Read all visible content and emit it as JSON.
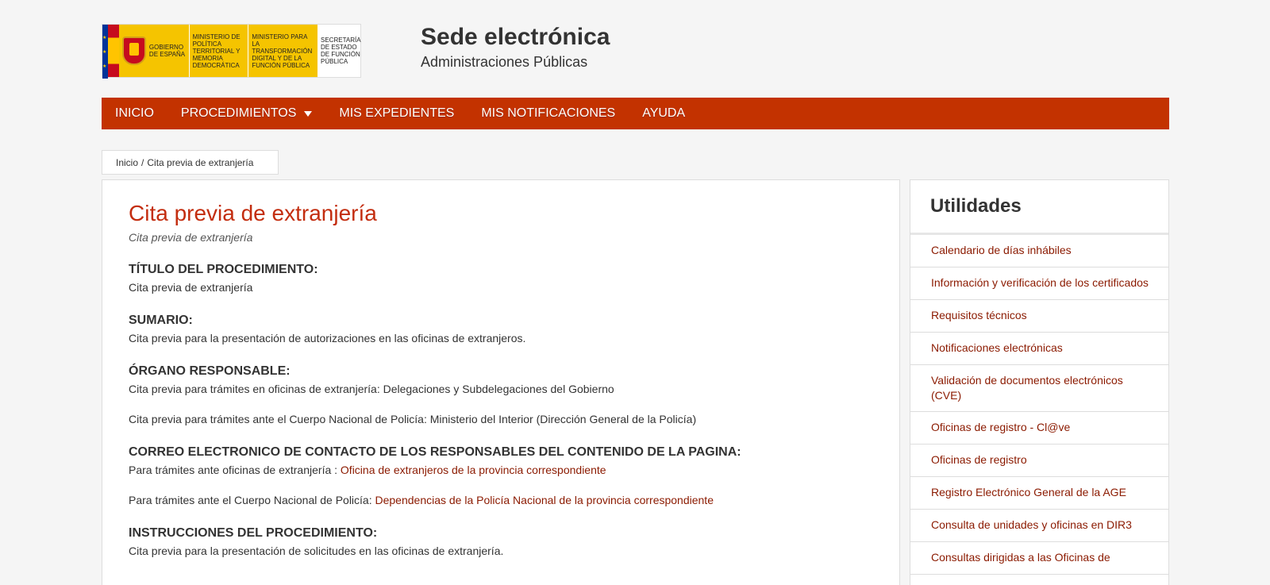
{
  "header": {
    "logo": {
      "block1": "GOBIERNO DE ESPAÑA",
      "block2": "MINISTERIO DE POLÍTICA TERRITORIAL Y MEMORIA DEMOCRÁTICA",
      "block3": "MINISTERIO PARA LA TRANSFORMACIÓN DIGITAL Y DE LA FUNCIÓN PÚBLICA",
      "block4": "SECRETARÍA DE ESTADO DE FUNCIÓN PÚBLICA"
    },
    "title": "Sede electrónica",
    "subtitle": "Administraciones Públicas"
  },
  "nav": {
    "items": [
      "INICIO",
      "PROCEDIMIENTOS",
      "MIS EXPEDIENTES",
      "MIS NOTIFICACIONES",
      "AYUDA"
    ]
  },
  "breadcrumb": {
    "home": "Inicio",
    "separator": "/",
    "current": "Cita previa de extranjería"
  },
  "main": {
    "title": "Cita previa de extranjería",
    "subtitle": "Cita previa de extranjería",
    "sections": {
      "titulo": {
        "heading": "TÍTULO DEL PROCEDIMIENTO:",
        "text": "Cita previa de extranjería"
      },
      "sumario": {
        "heading": "SUMARIO:",
        "text": "Cita previa para la presentación de autorizaciones en las oficinas de extranjeros."
      },
      "organo": {
        "heading": "ÓRGANO RESPONSABLE:",
        "text1": "Cita previa para trámites en oficinas de extranjería: Delegaciones y Subdelegaciones del Gobierno",
        "text2": "Cita previa para trámites ante el Cuerpo Nacional de Policía: Ministerio del Interior (Dirección General de la Policía)"
      },
      "correo": {
        "heading": "CORREO ELECTRONICO DE CONTACTO DE LOS RESPONSABLES DEL CONTENIDO DE LA PAGINA:",
        "line1_prefix": "Para trámites ante oficinas de extranjería : ",
        "line1_link": "Oficina de extranjeros de la provincia correspondiente",
        "line2_prefix": "Para trámites ante el Cuerpo Nacional de Policía: ",
        "line2_link": "Dependencias de la Policía Nacional de la provincia correspondiente"
      },
      "instrucciones": {
        "heading": "INSTRUCCIONES DEL PROCEDIMIENTO:",
        "text": "Cita previa para la presentación de solicitudes en las oficinas de extranjería."
      }
    }
  },
  "sidebar": {
    "title": "Utilidades",
    "items": [
      "Calendario de días inhábiles",
      "Información y verificación de los certificados",
      "Requisitos técnicos",
      "Notificaciones electrónicas",
      "Validación de documentos electrónicos (CVE)",
      "Oficinas de registro - Cl@ve",
      "Oficinas de registro",
      "Registro Electrónico General de la AGE",
      "Consulta de unidades y oficinas en DIR3",
      "Consultas dirigidas a las Oficinas de"
    ]
  },
  "colors": {
    "nav_bg": "#c33200",
    "title_red": "#c32d0f",
    "link": "#8b1a00"
  }
}
